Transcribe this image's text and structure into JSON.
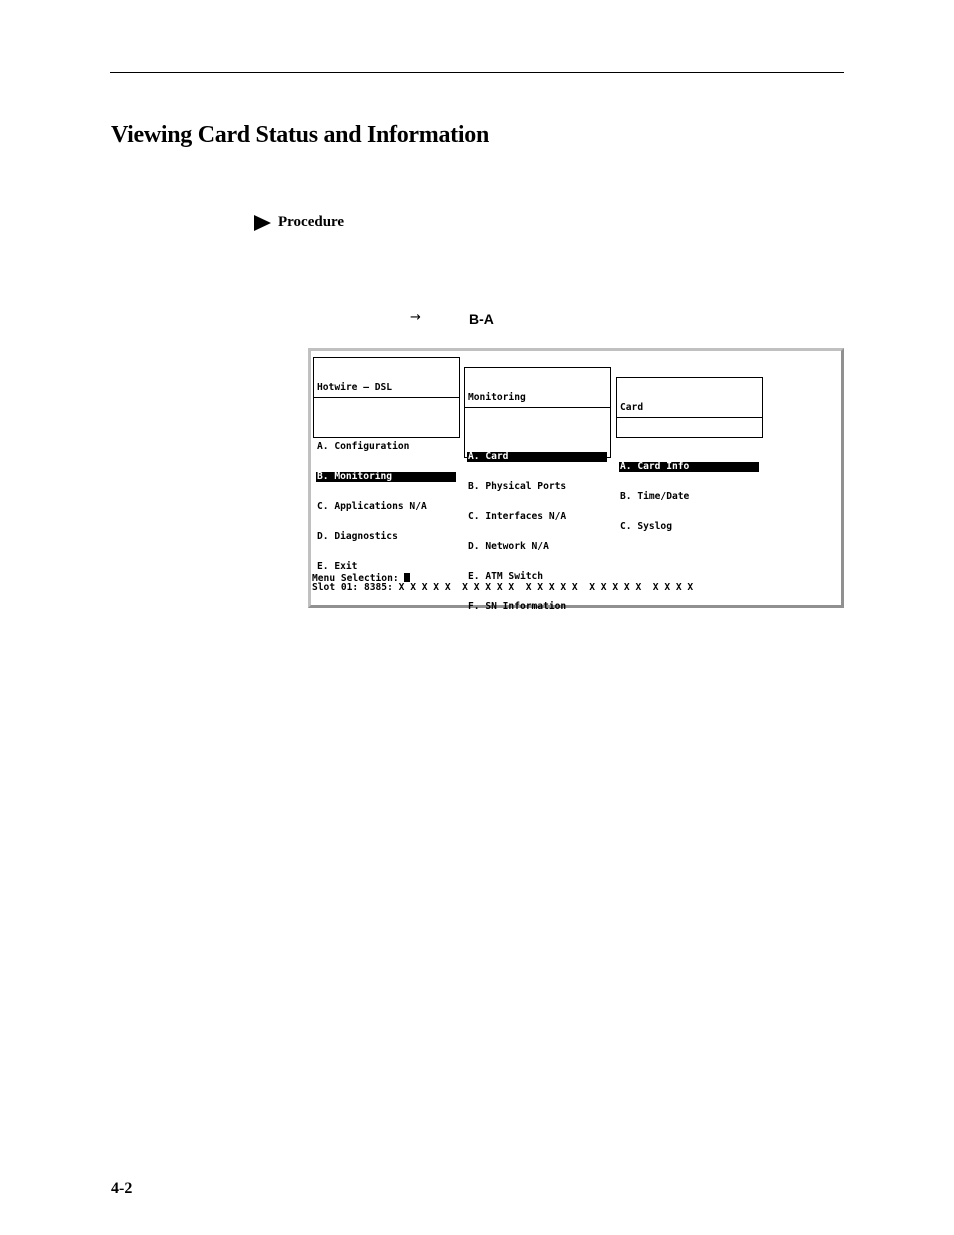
{
  "page": {
    "title": "Viewing Card Status and Information",
    "procedure_label": "Procedure",
    "path_arrow": "→",
    "path_keys": "B-A",
    "page_number": "4-2"
  },
  "terminal": {
    "menus": [
      {
        "title": "Hotwire – DSL",
        "items": [
          {
            "label": "A. Configuration",
            "selected": false
          },
          {
            "label": "B. Monitoring",
            "selected": true
          },
          {
            "label": "C. Applications N/A",
            "selected": false
          },
          {
            "label": "D. Diagnostics",
            "selected": false
          },
          {
            "label": "E. Exit",
            "selected": false
          }
        ]
      },
      {
        "title": "Monitoring",
        "items": [
          {
            "label": "A. Card",
            "selected": true
          },
          {
            "label": "B. Physical Ports",
            "selected": false
          },
          {
            "label": "C. Interfaces N/A",
            "selected": false
          },
          {
            "label": "D. Network N/A",
            "selected": false
          },
          {
            "label": "E. ATM Switch",
            "selected": false
          },
          {
            "label": "F. SN Information",
            "selected": false
          }
        ]
      },
      {
        "title": "Card",
        "items": [
          {
            "label": "A. Card Info",
            "selected": true
          },
          {
            "label": "B. Time/Date",
            "selected": false
          },
          {
            "label": "C. Syslog",
            "selected": false
          }
        ]
      }
    ],
    "prompt": "Menu Selection: ",
    "status_line": "Slot 01: 8385: X X X X X  X X X X X  X X X X X  X X X X X  X X X X"
  }
}
